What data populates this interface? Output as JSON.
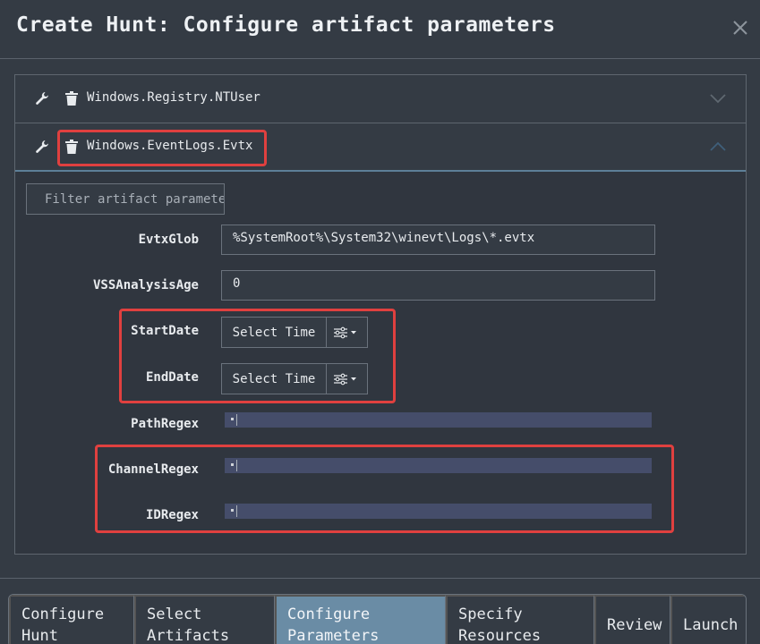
{
  "modal": {
    "title": "Create Hunt: Configure artifact parameters"
  },
  "artifacts": [
    {
      "name": "Windows.Registry.NTUser",
      "expanded": false
    },
    {
      "name": "Windows.EventLogs.Evtx",
      "expanded": true
    }
  ],
  "filter": {
    "placeholder": "Filter artifact parameters"
  },
  "params": {
    "evtx_glob": {
      "label": "EvtxGlob",
      "value": "%SystemRoot%\\System32\\winevt\\Logs\\*.evtx"
    },
    "vss_age": {
      "label": "VSSAnalysisAge",
      "value": "0"
    },
    "start_date": {
      "label": "StartDate",
      "button": "Select Time"
    },
    "end_date": {
      "label": "EndDate",
      "button": "Select Time"
    },
    "path_regex": {
      "label": "PathRegex",
      "value": "."
    },
    "channel_regex": {
      "label": "ChannelRegex",
      "value": "."
    },
    "id_regex": {
      "label": "IDRegex",
      "value": "."
    }
  },
  "wizard": [
    {
      "line1": "Configure",
      "line2": "Hunt",
      "active": false
    },
    {
      "line1": "Select",
      "line2": "Artifacts",
      "active": false
    },
    {
      "line1": "Configure",
      "line2": "Parameters",
      "active": true
    },
    {
      "line1": "Specify",
      "line2": "Resources",
      "active": false
    },
    {
      "line1": "Review",
      "line2": "",
      "active": false
    },
    {
      "line1": "Launch",
      "line2": "",
      "active": false
    }
  ],
  "colors": {
    "background": "#343b44",
    "accent_active_step": "#6a8ca5",
    "highlight": "#e0403f",
    "regex_field": "#454d6a"
  }
}
